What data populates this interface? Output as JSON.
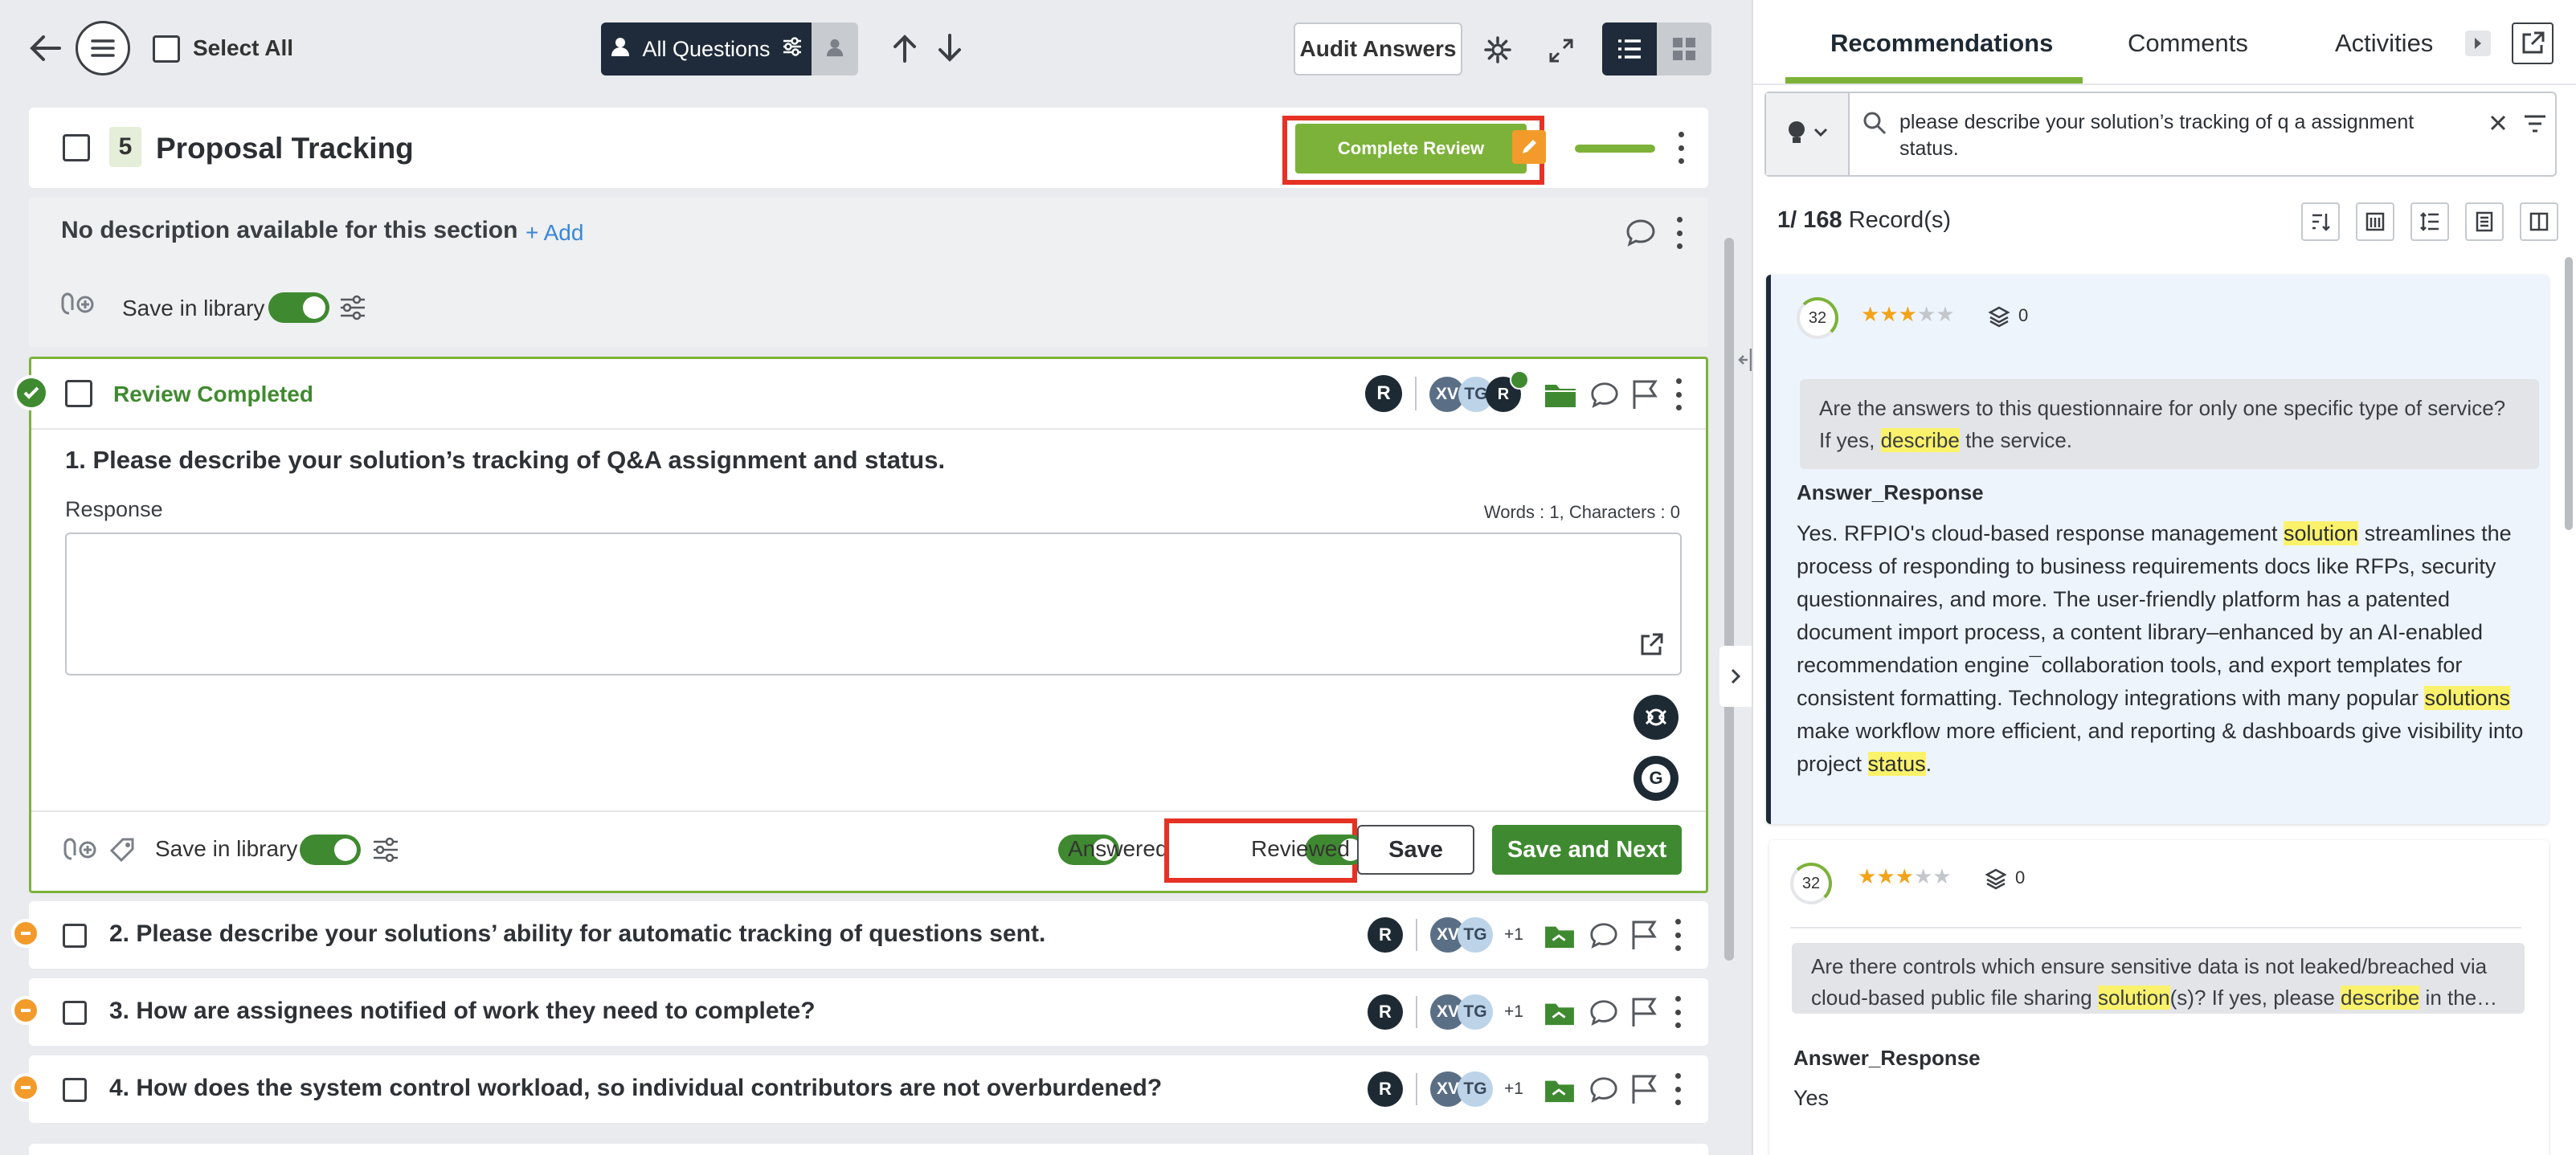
{
  "toolbar": {
    "select_all": "Select All",
    "filter_label": "All Questions",
    "audit_answers": "Audit Answers"
  },
  "section": {
    "number": "5",
    "title": "Proposal Tracking",
    "complete_review": "Complete Review",
    "progress": 1.0,
    "description": "No description available for this section",
    "add": "+ Add",
    "save_in_library": "Save in library"
  },
  "question1": {
    "status": "Review Completed",
    "text": "1. Please describe your solution’s tracking of Q&A assignment and status.",
    "response_label": "Response",
    "counts": "Words : 1, Characters : 0",
    "save_in_library": "Save in library",
    "answered": "Answered",
    "reviewed": "Reviewed",
    "save": "Save",
    "save_next": "Save and Next",
    "avatars": [
      "XV",
      "TG"
    ]
  },
  "questions": [
    {
      "text": "2. Please describe your solutions’ ability for automatic tracking of questions sent.",
      "avatars": [
        "XV",
        "TG"
      ],
      "more": "+1"
    },
    {
      "text": "3. How are assignees notified of work they need to complete?",
      "avatars": [
        "XV",
        "TG"
      ],
      "more": "+1"
    },
    {
      "text": "4. How does the system control workload, so individual contributors are not overburdened?",
      "avatars": [
        "XV",
        "TG"
      ],
      "more": "+1"
    }
  ],
  "panel": {
    "tabs": [
      "Recommendations",
      "Comments",
      "Activities"
    ],
    "search_text": "please describe your solution’s tracking of q a assignment status.",
    "record_count": "1/ 168",
    "records_label": "Record(s)"
  },
  "results": [
    {
      "score": "32",
      "stars": 3,
      "versions": "0",
      "question_parts": [
        "Are the answers to this questionnaire for only one specific type of service? If yes, ",
        "describe",
        " the service."
      ],
      "answer_label": "Answer_Response",
      "answer_parts": [
        "Yes. RFPIO's cloud-based response management ",
        "solution",
        " streamlines the process of responding to business requirements docs like RFPs, security questionnaires, and more. The user-friendly platform has a patented document import process, a content library–enhanced by an AI-enabled recommendation engine¯collaboration tools, and export templates for consistent formatting. Technology integrations with many popular ",
        "solutions",
        " make workflow more efficient, and reporting & dashboards give visibility into project ",
        "status",
        "."
      ]
    },
    {
      "score": "32",
      "stars": 3,
      "versions": "0",
      "question_parts": [
        "Are there controls which ensure sensitive data is not leaked/breached via cloud-based public file sharing ",
        "solution",
        "(s)? If yes, please ",
        "describe",
        " in the…"
      ],
      "answer_label": "Answer_Response",
      "answer_text": "Yes"
    }
  ],
  "colors": {
    "green": "#3f8a30",
    "complete_review_bg": "#7db23a",
    "highlight": "#fbf26b",
    "red_box": "#e53224",
    "orange": "#f29b2b",
    "navy": "#1e2a3a"
  }
}
